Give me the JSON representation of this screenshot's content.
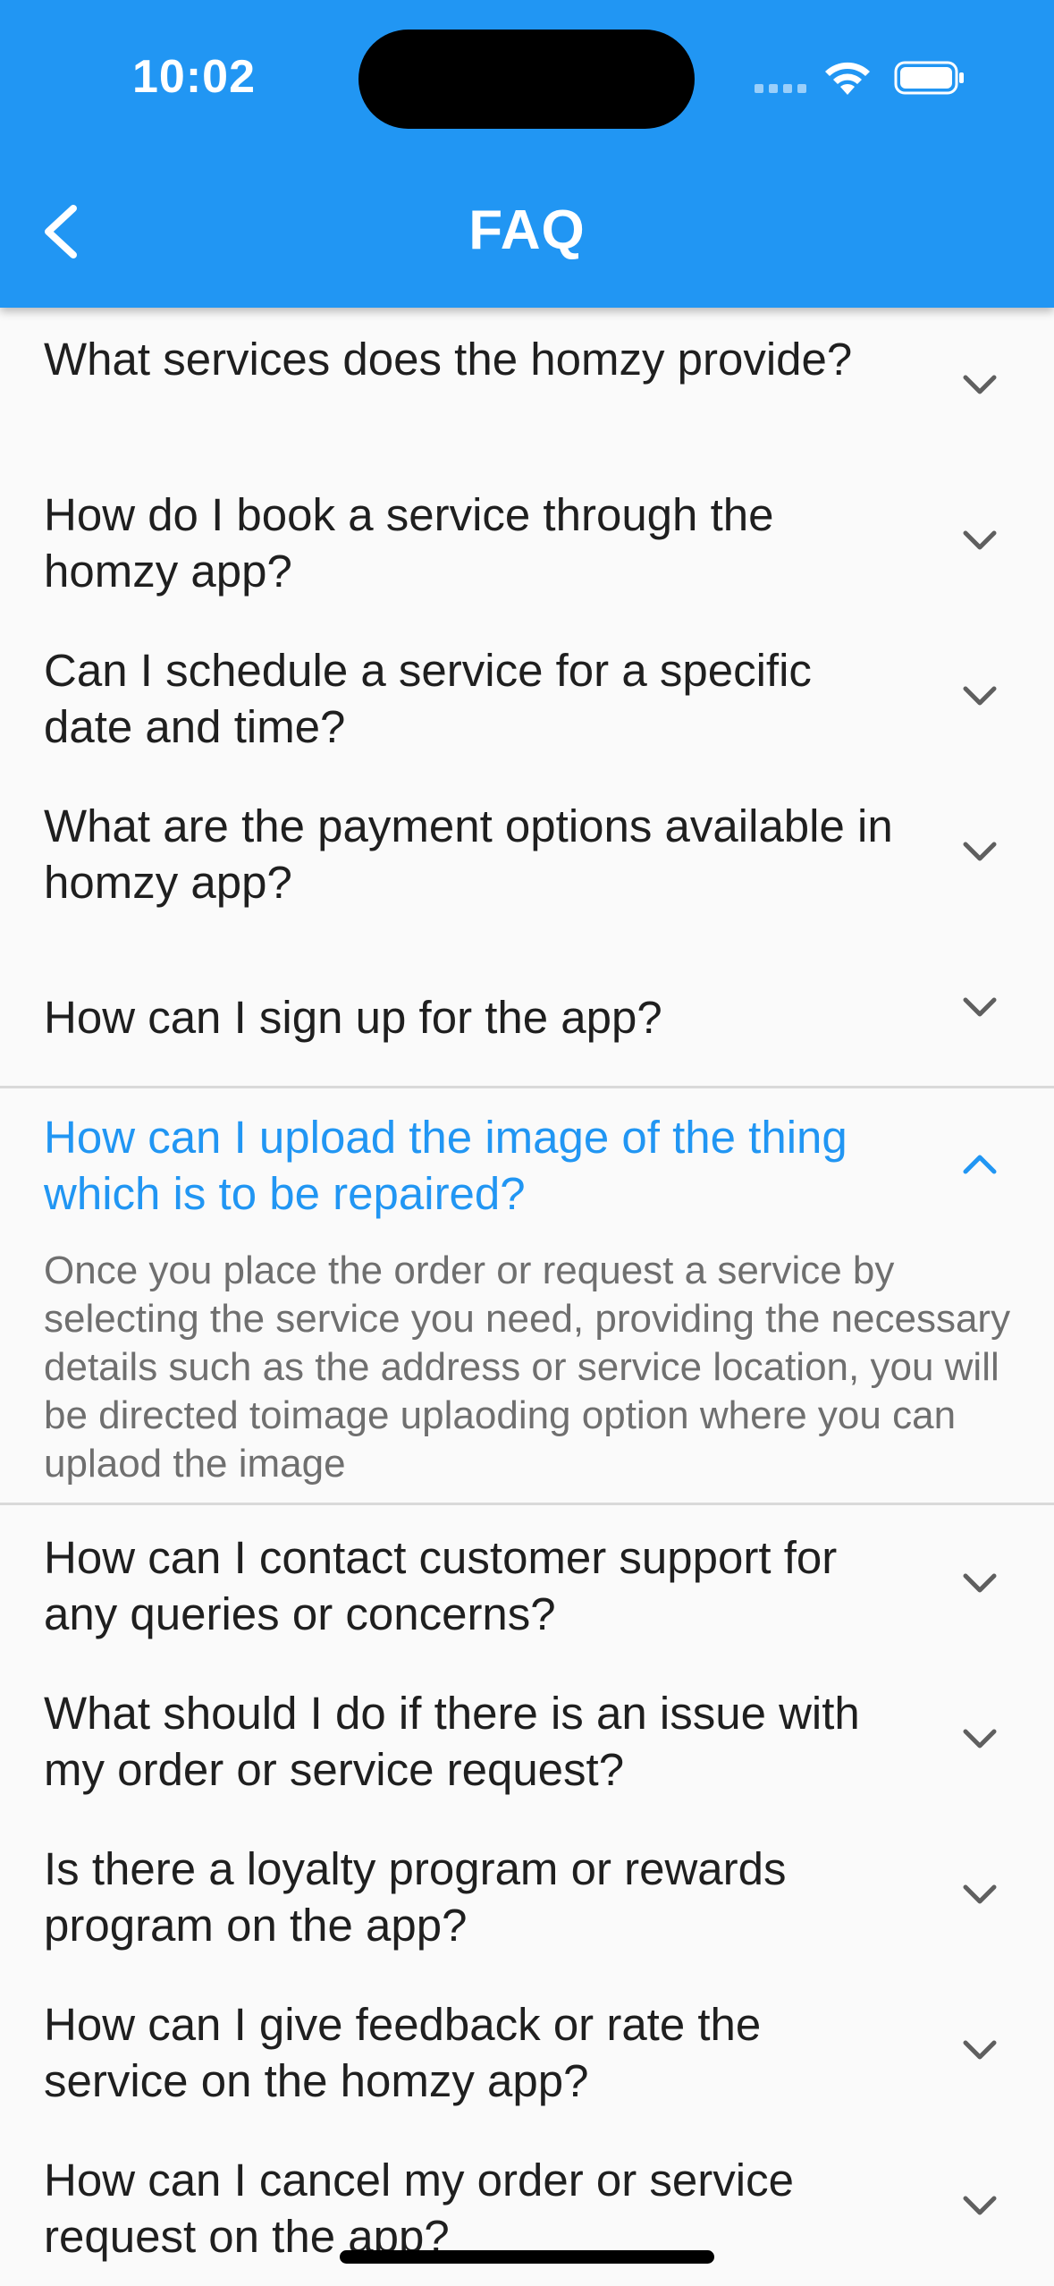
{
  "status_bar": {
    "time": "10:02"
  },
  "header": {
    "title": "FAQ",
    "back_icon": "chevron-left-icon"
  },
  "faqs": [
    {
      "question": "What services does the homzy provide?",
      "expanded": false
    },
    {
      "question": "How do I book a service through the homzy app?",
      "expanded": false
    },
    {
      "question": "Can I schedule a service for a specific date and time?",
      "expanded": false
    },
    {
      "question": "What are the payment options available in homzy app?",
      "expanded": false
    },
    {
      "question": "How can I sign up for the app?",
      "expanded": false
    },
    {
      "question": "How can I upload the image of the thing which is to be repaired?",
      "expanded": true,
      "answer": "Once you place the order or request a service by selecting the service you need, providing the necessary details such as the address or service location, you will be directed toimage uplaoding option where you can uplaod the image"
    },
    {
      "question": "How can I contact customer support for any queries or concerns?",
      "expanded": false
    },
    {
      "question": "What should I do if there is an issue with my order or service request?",
      "expanded": false
    },
    {
      "question": "Is there a loyalty program or rewards program on the app?",
      "expanded": false
    },
    {
      "question": "How can I give feedback or rate the service on the homzy app?",
      "expanded": false
    },
    {
      "question": "How can I cancel my order or service request on the app?",
      "expanded": false
    }
  ],
  "colors": {
    "app_bar": "#2196f3",
    "expanded_question": "#2196f3",
    "question_text": "#1f1f1f",
    "answer_text": "#6f6f6f",
    "background": "#fafafa"
  }
}
